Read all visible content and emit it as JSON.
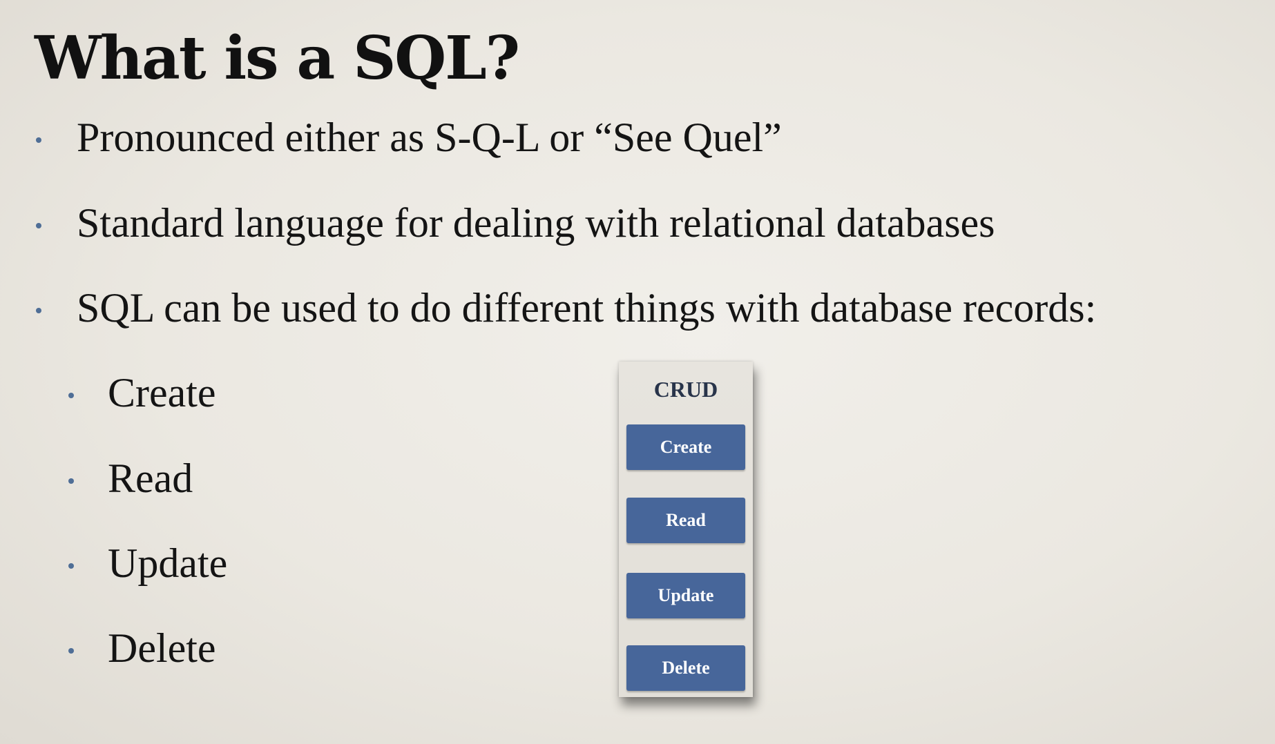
{
  "slide": {
    "title": "What is a SQL?",
    "bullets": [
      "Pronounced either as S-Q-L or “See Quel”",
      "Standard language for dealing with relational databases",
      "SQL can be used to do different things with database records:"
    ],
    "sub_bullets": [
      "Create",
      "Read",
      "Update",
      "Delete"
    ]
  },
  "crud_panel": {
    "title": "CRUD",
    "buttons": [
      "Create",
      "Read",
      "Update",
      "Delete"
    ]
  },
  "colors": {
    "background": "#ebe8e1",
    "bullet_dot": "#4f6e96",
    "button_fill": "#47669a",
    "panel_title": "#28344a"
  }
}
